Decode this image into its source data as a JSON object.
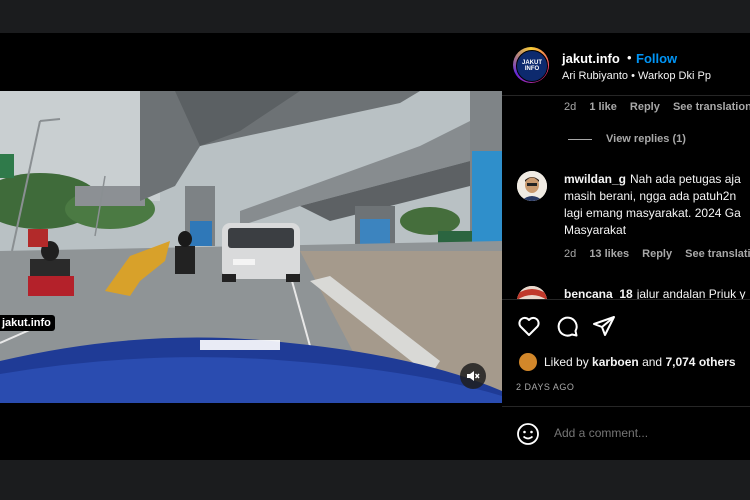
{
  "post": {
    "username": "jakut.info",
    "separator": "•",
    "follow_label": "Follow",
    "location": "Ari Rubiyanto • Warkop Dki Pp",
    "avatar_text": "JAKUT INFO"
  },
  "video": {
    "watermark": "jakut.info",
    "mute_icon": "speaker-muted-icon"
  },
  "comments": {
    "first_meta": {
      "time": "2d",
      "likes": "1 like",
      "reply": "Reply",
      "translate": "See translation"
    },
    "view_replies": "View replies (1)",
    "items": [
      {
        "user": "mwildan_g",
        "lines": [
          "Nah ada petugas aja",
          "masih berani, ngga ada patuh2n",
          "lagi emang masyarakat. 2024 Ga",
          "Masyarakat"
        ],
        "time": "2d",
        "likes": "13 likes",
        "reply": "Reply",
        "translate": "See translation"
      },
      {
        "user": "bencana_18",
        "lines": [
          "jalur andalan Priuk y"
        ]
      }
    ]
  },
  "engagement": {
    "liked_by_prefix": "Liked by",
    "liked_user": "karboen",
    "liked_and": "and",
    "likes_count": "7,074 others",
    "time_ago": "2 DAYS AGO"
  },
  "composer": {
    "placeholder": "Add a comment..."
  },
  "colors": {
    "accent": "#0095f6",
    "panel_bg": "#000000",
    "page_bg": "#1b1c1e",
    "muted_text": "#a8a8a8"
  }
}
